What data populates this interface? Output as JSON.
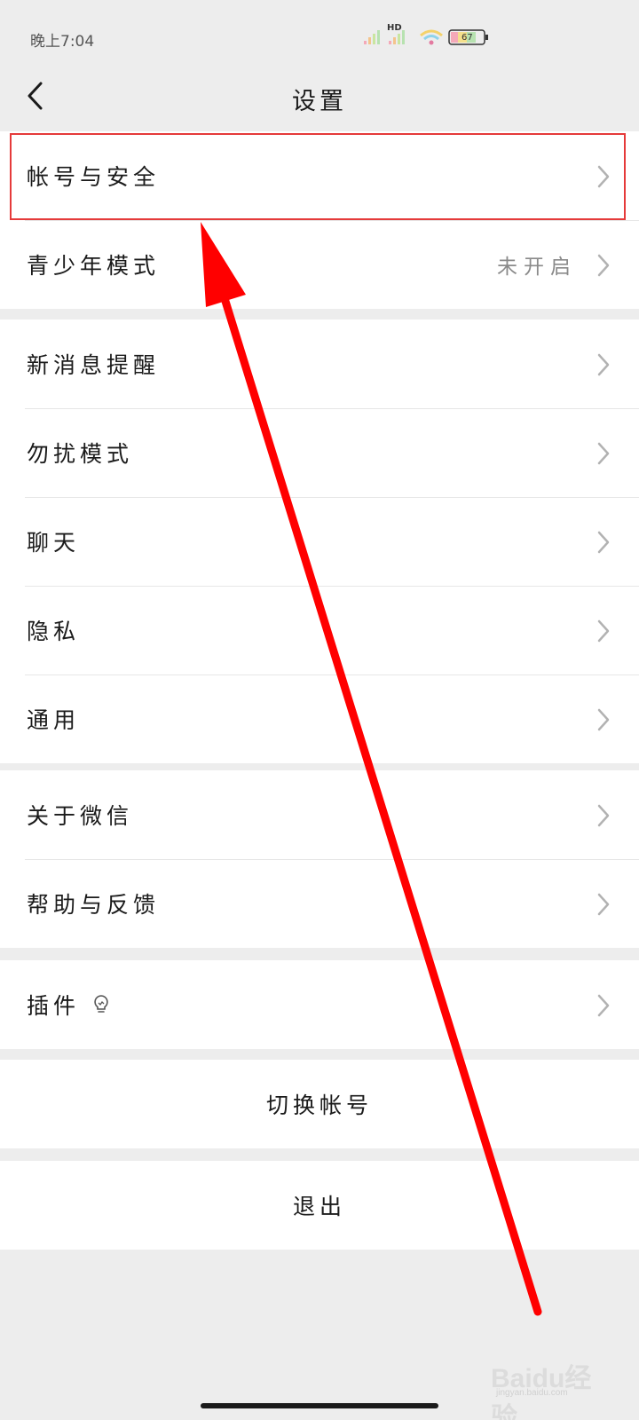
{
  "status_bar": {
    "time": "晚上7:04",
    "network": "HD",
    "battery": "67"
  },
  "header": {
    "title": "设置"
  },
  "groups": [
    {
      "items": [
        {
          "label": "帐号与安全",
          "value": ""
        },
        {
          "label": "青少年模式",
          "value": "未开启"
        }
      ]
    },
    {
      "items": [
        {
          "label": "新消息提醒"
        },
        {
          "label": "勿扰模式"
        },
        {
          "label": "聊天"
        },
        {
          "label": "隐私"
        },
        {
          "label": "通用"
        }
      ]
    },
    {
      "items": [
        {
          "label": "关于微信"
        },
        {
          "label": "帮助与反馈"
        }
      ]
    },
    {
      "items": [
        {
          "label": "插件",
          "icon": "lightbulb-icon"
        }
      ]
    }
  ],
  "actions": {
    "switch_account": "切换帐号",
    "logout": "退出"
  },
  "watermark": {
    "brand": "Baidu经验",
    "url": "jingyan.baidu.com"
  },
  "colors": {
    "annotation_red": "#ff0000",
    "background": "#ededed",
    "row_background": "#ffffff"
  }
}
